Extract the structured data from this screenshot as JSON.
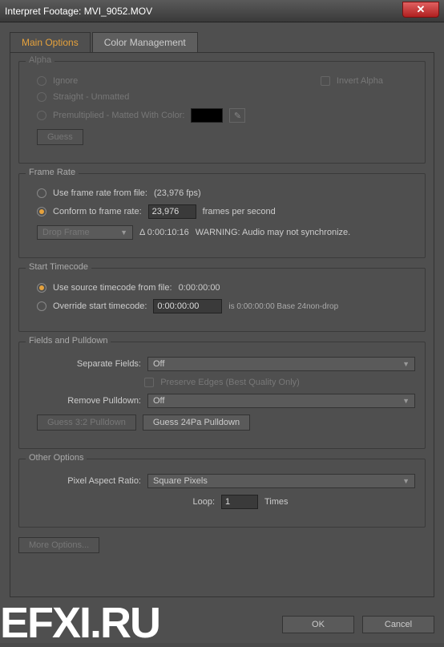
{
  "window": {
    "title": "Interpret Footage: MVI_9052.MOV"
  },
  "tabs": {
    "main": "Main Options",
    "color": "Color Management"
  },
  "alpha": {
    "title": "Alpha",
    "ignore": "Ignore",
    "invert": "Invert Alpha",
    "straight": "Straight - Unmatted",
    "premult": "Premultiplied - Matted With Color:",
    "guess": "Guess"
  },
  "frameRate": {
    "title": "Frame Rate",
    "fromFile": "Use frame rate from file:",
    "fromFileVal": "(23,976 fps)",
    "conform": "Conform to frame rate:",
    "conformVal": "23,976",
    "fpsLabel": "frames per second",
    "dropFrame": "Drop Frame",
    "delta": "Δ 0:00:10:16",
    "warning": "WARNING: Audio may not synchronize."
  },
  "startTc": {
    "title": "Start Timecode",
    "source": "Use source timecode from file:",
    "sourceVal": "0:00:00:00",
    "override": "Override start timecode:",
    "overrideVal": "0:00:00:00",
    "info": "is 0:00:00:00  Base 24non-drop"
  },
  "fields": {
    "title": "Fields and Pulldown",
    "separate": "Separate Fields:",
    "separateVal": "Off",
    "preserve": "Preserve Edges (Best Quality Only)",
    "remove": "Remove Pulldown:",
    "removeVal": "Off",
    "guess32": "Guess 3:2 Pulldown",
    "guess24": "Guess 24Pa Pulldown"
  },
  "other": {
    "title": "Other Options",
    "par": "Pixel Aspect Ratio:",
    "parVal": "Square Pixels",
    "loop": "Loop:",
    "loopVal": "1",
    "times": "Times"
  },
  "more": "More Options...",
  "ok": "OK",
  "cancel": "Cancel",
  "watermark": "EFXI.RU"
}
